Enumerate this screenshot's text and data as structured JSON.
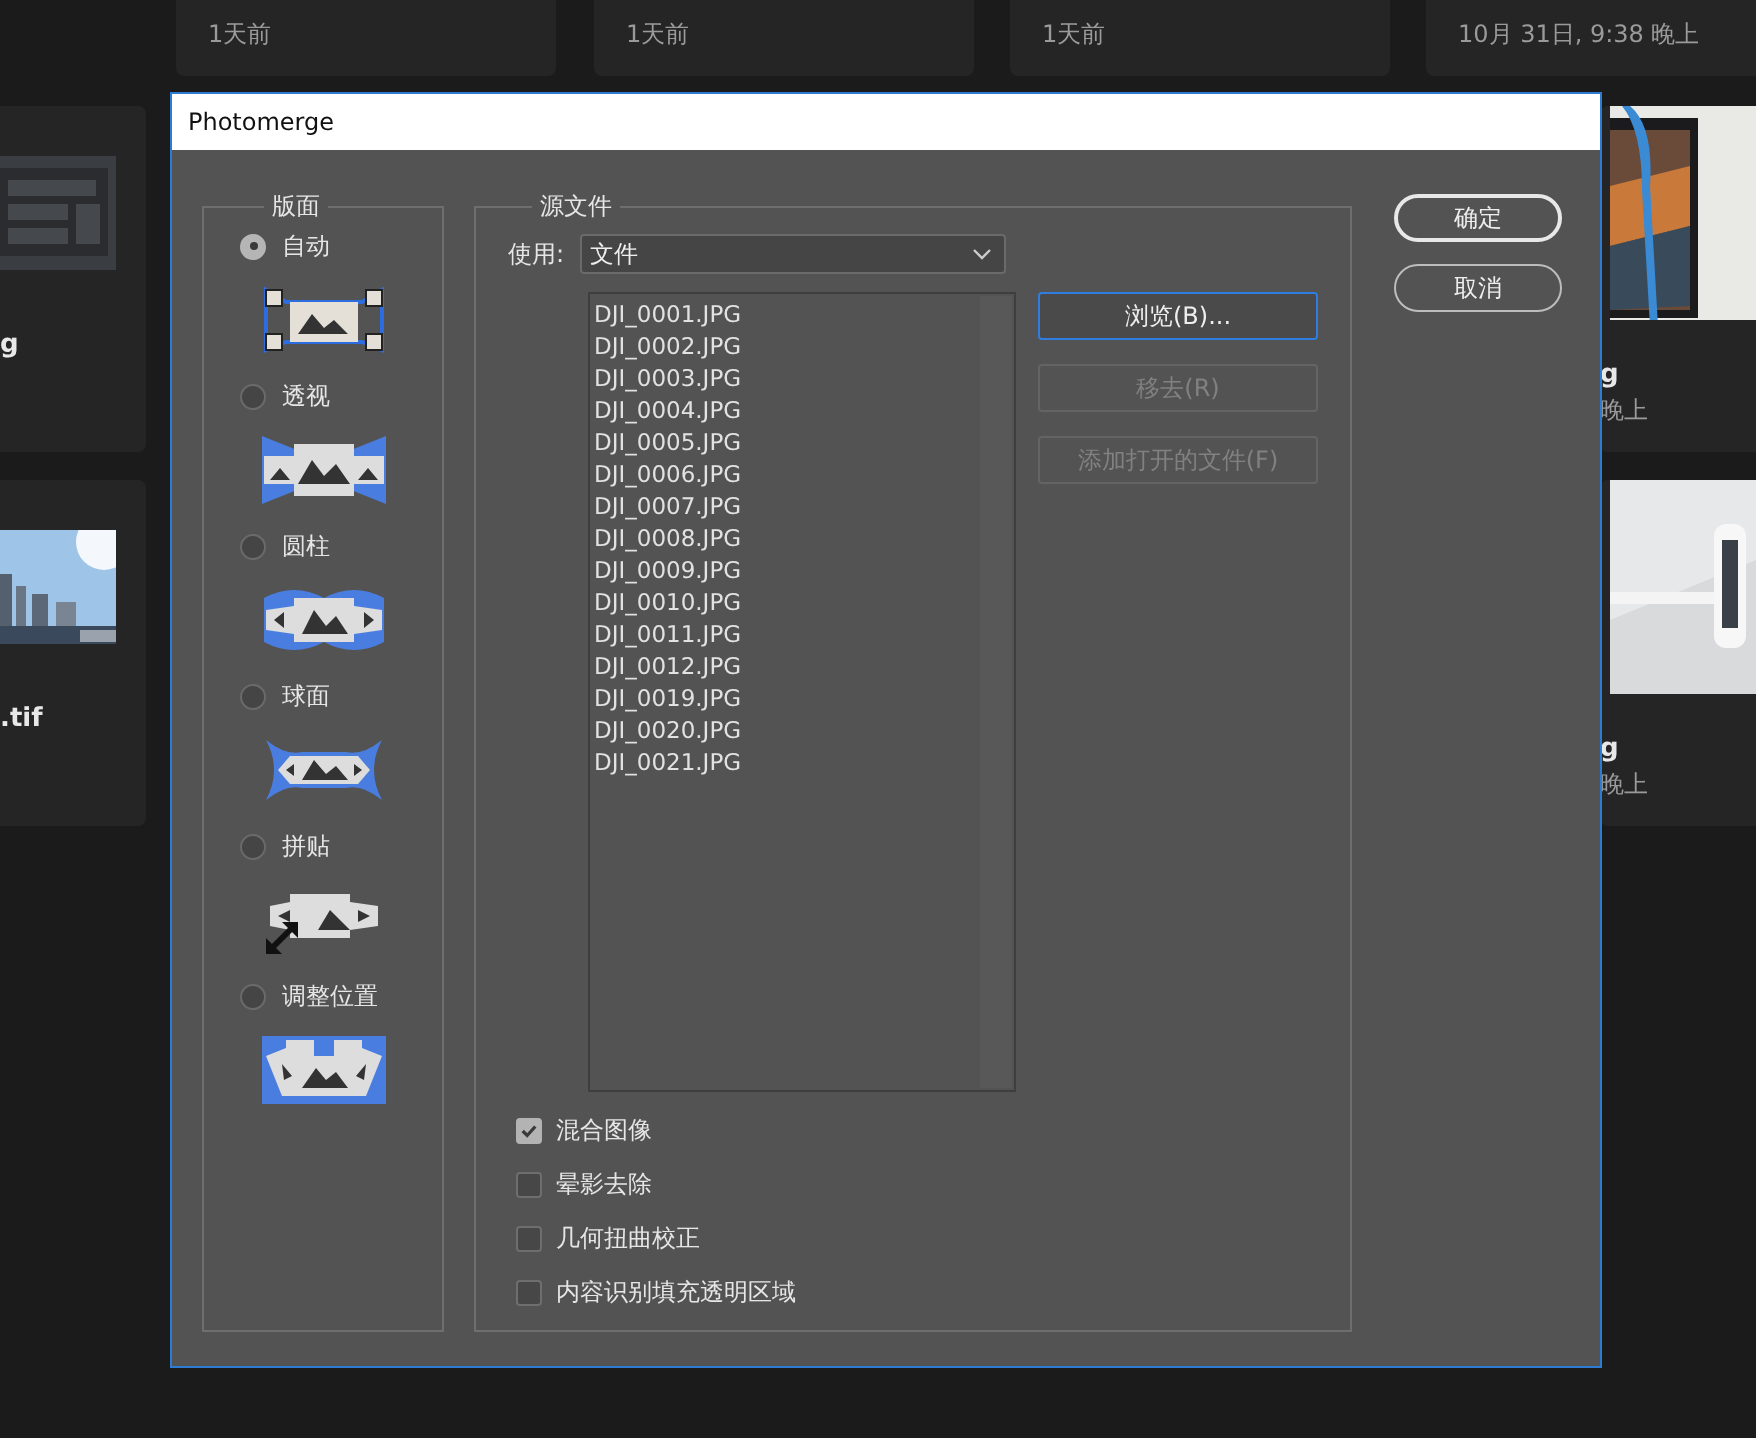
{
  "background": {
    "top_cards": [
      {
        "subtitle": "1天前"
      },
      {
        "subtitle": "1天前"
      },
      {
        "subtitle": "1天前"
      },
      {
        "subtitle": "10月 31日, 9:38 晚上"
      }
    ],
    "left_cards": [
      {
        "kind": "picture",
        "title": "g"
      },
      {
        "kind": "picture",
        "title": ".tif"
      }
    ],
    "right_cards": [
      {
        "kind": "picture",
        "title": "g",
        "subtitle": "晚上"
      },
      {
        "kind": "picture",
        "title": "g",
        "subtitle": "晚上"
      }
    ]
  },
  "dialog": {
    "title": "Photomerge",
    "layout_group": {
      "title": "版面",
      "options": [
        {
          "label": "自动",
          "kind": "auto",
          "selected": true
        },
        {
          "label": "透视",
          "kind": "perspective",
          "selected": false
        },
        {
          "label": "圆柱",
          "kind": "cylindrical",
          "selected": false
        },
        {
          "label": "球面",
          "kind": "spherical",
          "selected": false
        },
        {
          "label": "拼贴",
          "kind": "collage",
          "selected": false
        },
        {
          "label": "调整位置",
          "kind": "reposition",
          "selected": false
        }
      ]
    },
    "source_group": {
      "title": "源文件",
      "use_label": "使用:",
      "use_value": "文件",
      "files": [
        "DJI_0001.JPG",
        "DJI_0002.JPG",
        "DJI_0003.JPG",
        "DJI_0004.JPG",
        "DJI_0005.JPG",
        "DJI_0006.JPG",
        "DJI_0007.JPG",
        "DJI_0008.JPG",
        "DJI_0009.JPG",
        "DJI_0010.JPG",
        "DJI_0011.JPG",
        "DJI_0012.JPG",
        "DJI_0019.JPG",
        "DJI_0020.JPG",
        "DJI_0021.JPG"
      ],
      "buttons": [
        {
          "label": "浏览(B)...",
          "disabled": false
        },
        {
          "label": "移去(R)",
          "disabled": true
        },
        {
          "label": "添加打开的文件(F)",
          "disabled": true
        }
      ],
      "checkboxes": [
        {
          "label": "混合图像",
          "checked": true
        },
        {
          "label": "晕影去除",
          "checked": false
        },
        {
          "label": "几何扭曲校正",
          "checked": false
        },
        {
          "label": "内容识别填充透明区域",
          "checked": false
        }
      ]
    },
    "buttons": [
      {
        "label": "确定",
        "default": true
      },
      {
        "label": "取消",
        "default": false
      }
    ]
  }
}
